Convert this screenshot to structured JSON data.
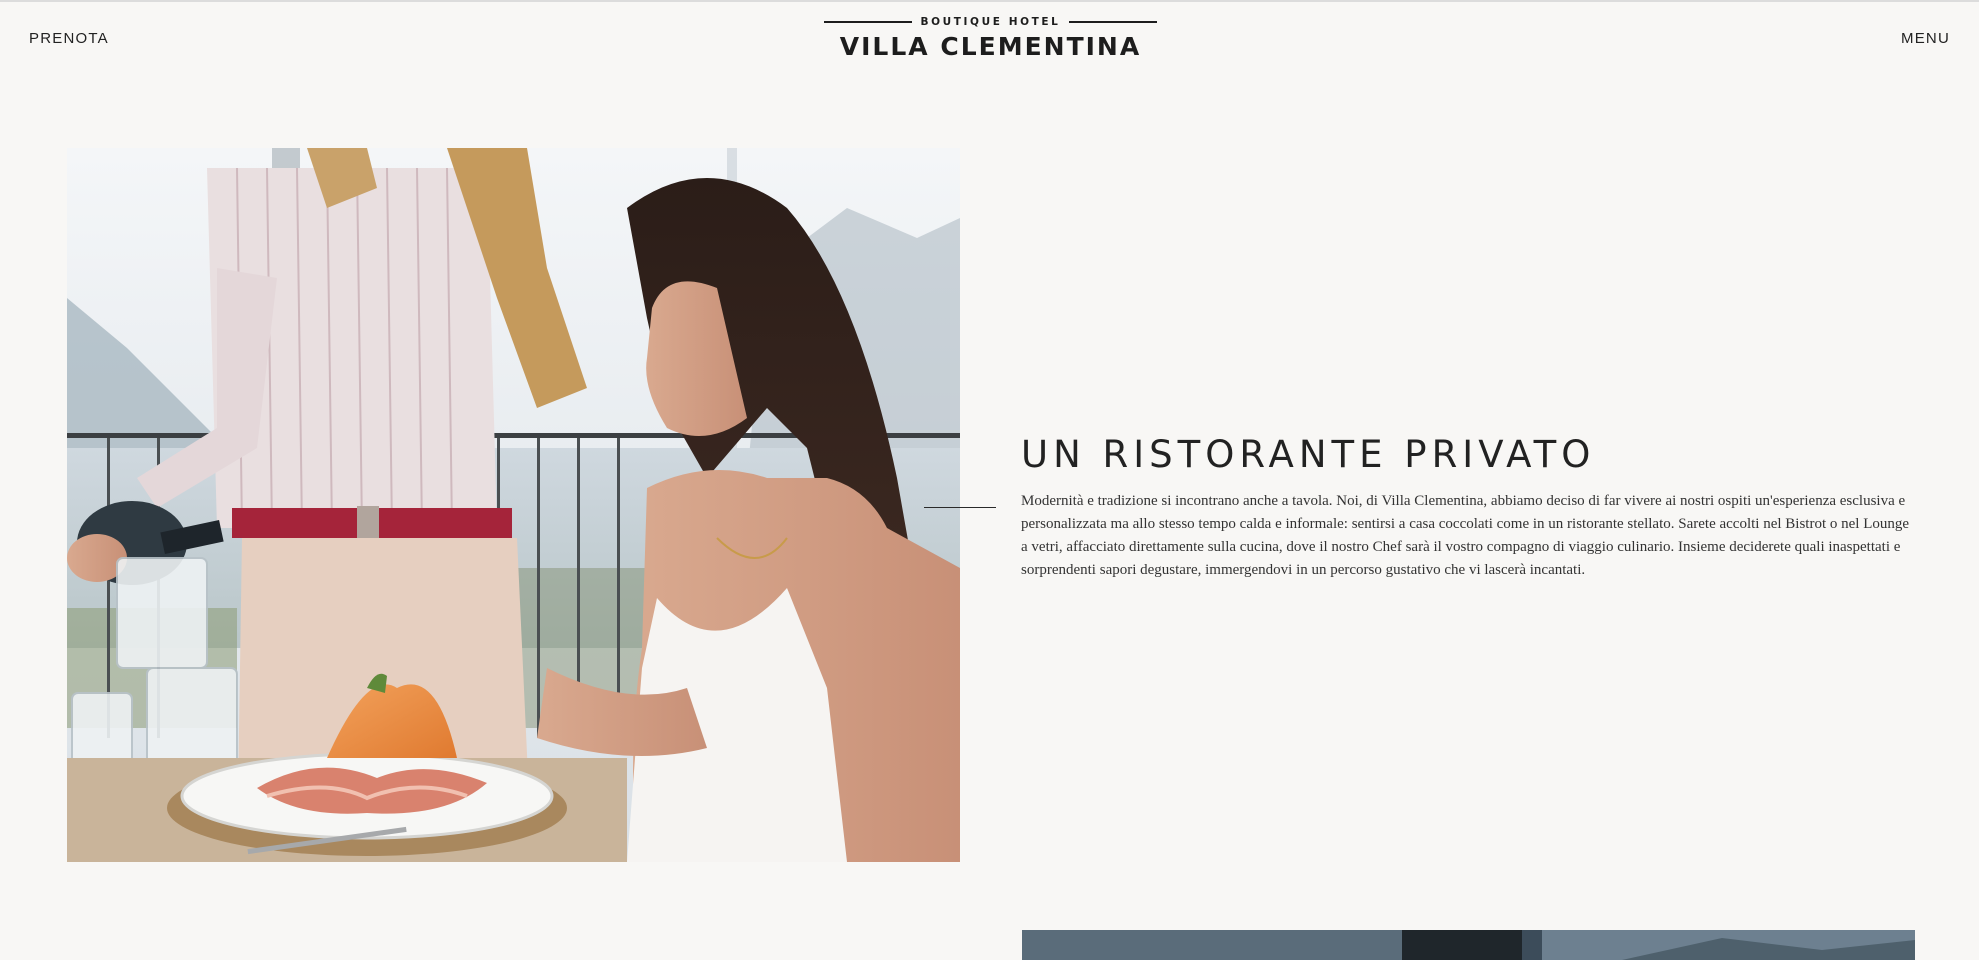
{
  "header": {
    "left_link": "PRENOTA",
    "right_link": "MENU",
    "logo_subtitle": "BOUTIQUE HOTEL",
    "logo_title": "VILLA CLEMENTINA"
  },
  "section": {
    "title": "UN RISTORANTE PRIVATO",
    "body": "Modernità e tradizione si incontrano anche a tavola. Noi, di Villa Clementina, abbiamo deciso di far vivere ai nostri ospiti un'esperienza esclusiva e personalizzata ma allo stesso tempo calda e informale: sentirsi a casa coccolati come in un ristorante stellato. Sarete accolti nel Bistrot o nel Lounge a vetri, affacciato direttamente sulla cucina, dove il nostro Chef sarà il vostro compagno di viaggio culinario. Insieme deciderete quali inaspettati e sorprendenti sapori degustare, immergendovi in un percorso gustativo che vi lascerà incantati."
  },
  "colors": {
    "background": "#f8f7f5",
    "text": "#1d1d1d"
  }
}
